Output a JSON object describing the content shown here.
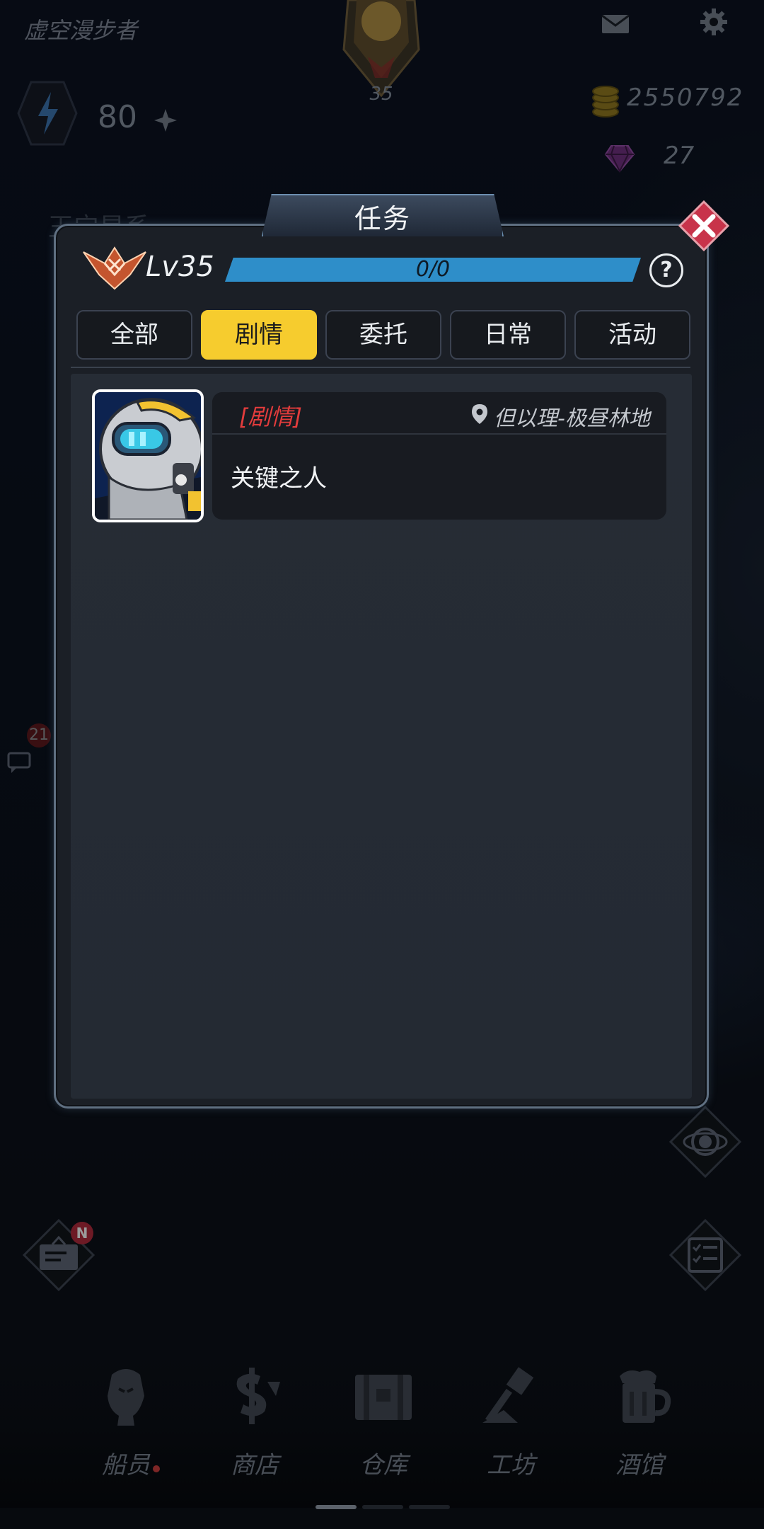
{
  "hud": {
    "player_name": "虚空漫步者",
    "avatar_level": "35",
    "energy": "80",
    "coins": "2550792",
    "gems": "27",
    "background_label": "王宁星系",
    "side_badge_count": "21",
    "notice_badge": "N"
  },
  "modal": {
    "title": "任务",
    "level": "Lv35",
    "progress_text": "0/0",
    "progress_fraction": 0,
    "help_label": "?",
    "tabs": [
      {
        "label": "全部",
        "active": false
      },
      {
        "label": "剧情",
        "active": true
      },
      {
        "label": "委托",
        "active": false
      },
      {
        "label": "日常",
        "active": false
      },
      {
        "label": "活动",
        "active": false
      }
    ],
    "quests": [
      {
        "type": "[剧情]",
        "location": "但以理-极昼林地",
        "name": "关键之人"
      }
    ]
  },
  "bottom_nav": [
    {
      "label": "船员",
      "icon": "crew-icon",
      "has_dot": true
    },
    {
      "label": "商店",
      "icon": "shop-icon",
      "has_dot": false
    },
    {
      "label": "仓库",
      "icon": "warehouse-icon",
      "has_dot": false
    },
    {
      "label": "工坊",
      "icon": "workshop-icon",
      "has_dot": false
    },
    {
      "label": "酒馆",
      "icon": "tavern-icon",
      "has_dot": false
    }
  ],
  "colors": {
    "accent_yellow": "#f6cc2e",
    "progress_blue": "#2e8ec9",
    "quest_type_red": "#e23c3c",
    "close_red": "#c8334a"
  }
}
